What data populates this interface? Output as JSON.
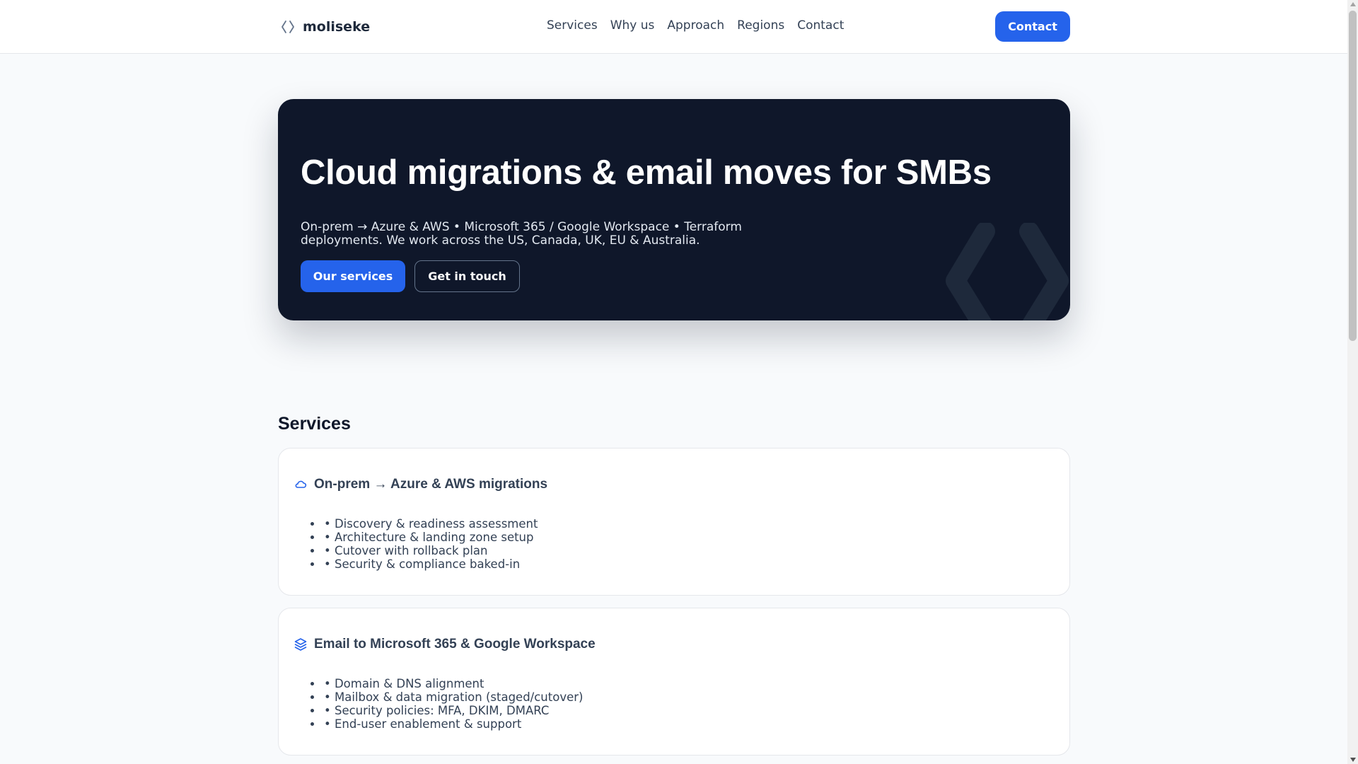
{
  "header": {
    "brand_name": "moliseke",
    "brand_icon": "code-brackets-icon",
    "nav": [
      "Services",
      "Why us",
      "Approach",
      "Regions",
      "Contact"
    ],
    "contact_button": "Contact"
  },
  "hero": {
    "title": "Cloud migrations & email moves for SMBs",
    "subtitle": "On-prem → Azure & AWS • Microsoft 365 / Google Workspace • Terraform deployments. We work across the US, Canada, UK, EU & Australia.",
    "primary_button": "Our services",
    "secondary_button": "Get in touch",
    "decor_icon": "code-brackets-icon"
  },
  "services": {
    "title": "Services",
    "cards": [
      {
        "icon": "cloud-icon",
        "title": "On-prem → Azure & AWS migrations",
        "items": [
          "• Discovery & readiness assessment",
          "• Architecture & landing zone setup",
          "• Cutover with rollback plan",
          "• Security & compliance baked-in"
        ]
      },
      {
        "icon": "layers-icon",
        "title": "Email to Microsoft 365 & Google Workspace",
        "items": [
          "• Domain & DNS alignment",
          "• Mailbox & data migration (staged/cutover)",
          "• Security policies: MFA, DKIM, DMARC",
          "• End-user enablement & support"
        ]
      }
    ]
  },
  "colors": {
    "accent": "#2563eb",
    "hero_bg": "#0f172a",
    "page_bg": "#f8fafc"
  }
}
